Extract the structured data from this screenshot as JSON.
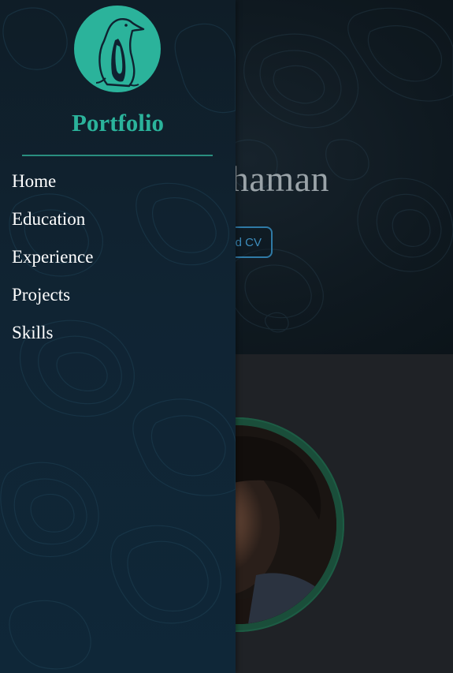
{
  "hero": {
    "name_fragment": "ahaman",
    "cv_button_fragment": "d CV"
  },
  "sidebar": {
    "brand": "Portfolio",
    "logo_icon": "penguin-icon",
    "items": [
      {
        "label": "Home"
      },
      {
        "label": "Education"
      },
      {
        "label": "Experience"
      },
      {
        "label": "Projects"
      },
      {
        "label": "Skills"
      }
    ]
  },
  "colors": {
    "accent": "#2bb39b",
    "sidebar_bg": "#0f2230",
    "hero_bg": "#0f1920",
    "button_border": "#2f7aa6",
    "ring": "#1a4e3a"
  }
}
